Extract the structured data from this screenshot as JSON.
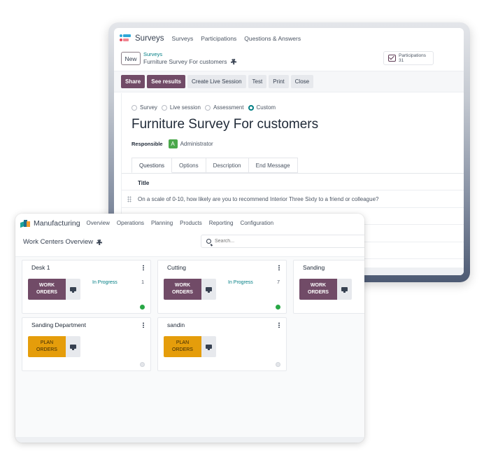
{
  "surveys_window": {
    "app_name": "Surveys",
    "logo_icon": "surveys-app-icon",
    "menu": [
      "Surveys",
      "Participations",
      "Questions & Answers"
    ],
    "new_button": "New",
    "breadcrumb_parent": "Surveys",
    "breadcrumb_current": "Furniture Survey For customers",
    "participations_button": {
      "label": "Participations",
      "count": "31",
      "icon": "checkbox-icon"
    },
    "actions": {
      "primary": [
        "Share",
        "See results"
      ],
      "secondary": [
        "Create Live Session",
        "Test",
        "Print",
        "Close"
      ]
    },
    "survey_types": [
      {
        "label": "Survey",
        "selected": false
      },
      {
        "label": "Live session",
        "selected": false
      },
      {
        "label": "Assessment",
        "selected": false
      },
      {
        "label": "Custom",
        "selected": true
      }
    ],
    "title": "Furniture Survey For customers",
    "responsible_label": "Responsible",
    "responsible_avatar": "A",
    "responsible_value": "Administrator",
    "tabs": [
      {
        "label": "Questions",
        "active": true
      },
      {
        "label": "Options",
        "active": false
      },
      {
        "label": "Description",
        "active": false
      },
      {
        "label": "End Message",
        "active": false
      }
    ],
    "table_header": "Title",
    "questions": [
      "On a scale of 0-10, how likely are you to recommend Interior Three Sixty to a friend or colleague?"
    ]
  },
  "manufacturing_window": {
    "app_name": "Manufacturing",
    "logo_icon": "manufacturing-app-icon",
    "menu": [
      "Overview",
      "Operations",
      "Planning",
      "Products",
      "Reporting",
      "Configuration"
    ],
    "page_title": "Work Centers Overview",
    "search_placeholder": "Search...",
    "work_centers": [
      {
        "name": "Desk 1",
        "button_line1": "WORK",
        "button_line2": "ORDERS",
        "button_type": "work",
        "status": "In Progress",
        "count": "1",
        "state": "green",
        "colors": {
          "button": "#714b67"
        }
      },
      {
        "name": "Cutting",
        "button_line1": "WORK",
        "button_line2": "ORDERS",
        "button_type": "work",
        "status": "In Progress",
        "count": "7",
        "state": "green",
        "colors": {
          "button": "#714b67"
        }
      },
      {
        "name": "Sanding",
        "button_line1": "WORK",
        "button_line2": "ORDERS",
        "button_type": "work",
        "status": "",
        "count": "",
        "state": "",
        "colors": {
          "button": "#714b67"
        }
      },
      {
        "name": "Sanding Department",
        "button_line1": "PLAN",
        "button_line2": "ORDERS",
        "button_type": "plan",
        "status": "",
        "count": "",
        "state": "grey",
        "colors": {
          "button": "#e59d0b"
        }
      },
      {
        "name": "sandin",
        "button_line1": "PLAN",
        "button_line2": "ORDERS",
        "button_type": "plan",
        "status": "",
        "count": "",
        "state": "grey",
        "colors": {
          "button": "#e59d0b"
        }
      }
    ]
  },
  "colors": {
    "brand_primary": "#714b67",
    "accent_teal": "#017e84",
    "plan_orange": "#e59d0b",
    "status_green": "#28a745"
  }
}
